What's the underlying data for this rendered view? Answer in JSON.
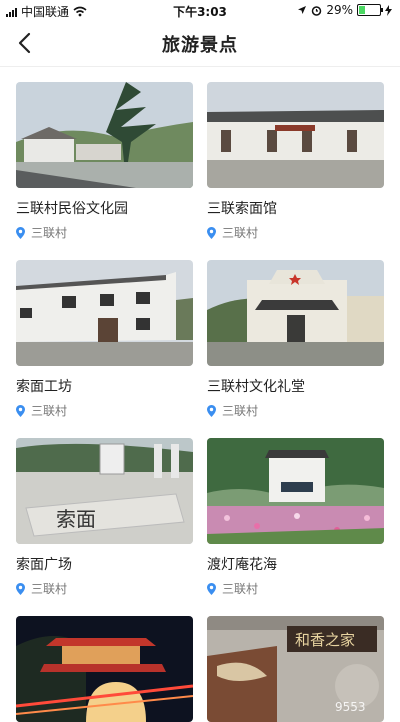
{
  "status_bar": {
    "carrier": "中国联通",
    "time": "下午3:03",
    "battery": "29%",
    "battery_level": 0.29,
    "icons": [
      "signal-icon",
      "wifi-icon",
      "location-arrow-icon",
      "alarm-icon",
      "battery-icon",
      "charging-icon"
    ]
  },
  "nav": {
    "back_icon": "chevron-left-icon",
    "title": "旅游景点"
  },
  "attractions": [
    {
      "name": "三联村民俗文化园",
      "location": "三联村"
    },
    {
      "name": "三联索面馆",
      "location": "三联村"
    },
    {
      "name": "索面工坊",
      "location": "三联村"
    },
    {
      "name": "三联村文化礼堂",
      "location": "三联村"
    },
    {
      "name": "索面广场",
      "location": "三联村"
    },
    {
      "name": "渡灯庵花海",
      "location": "三联村"
    },
    {
      "name": "",
      "location": ""
    },
    {
      "name": "",
      "location": ""
    }
  ],
  "image_text": {
    "calligraphy": "和香之家",
    "plaza": "索面",
    "watermark": "9553"
  },
  "colors": {
    "accent_pin": "#3a8ef0",
    "text_primary": "#222222",
    "text_secondary": "#777777"
  }
}
